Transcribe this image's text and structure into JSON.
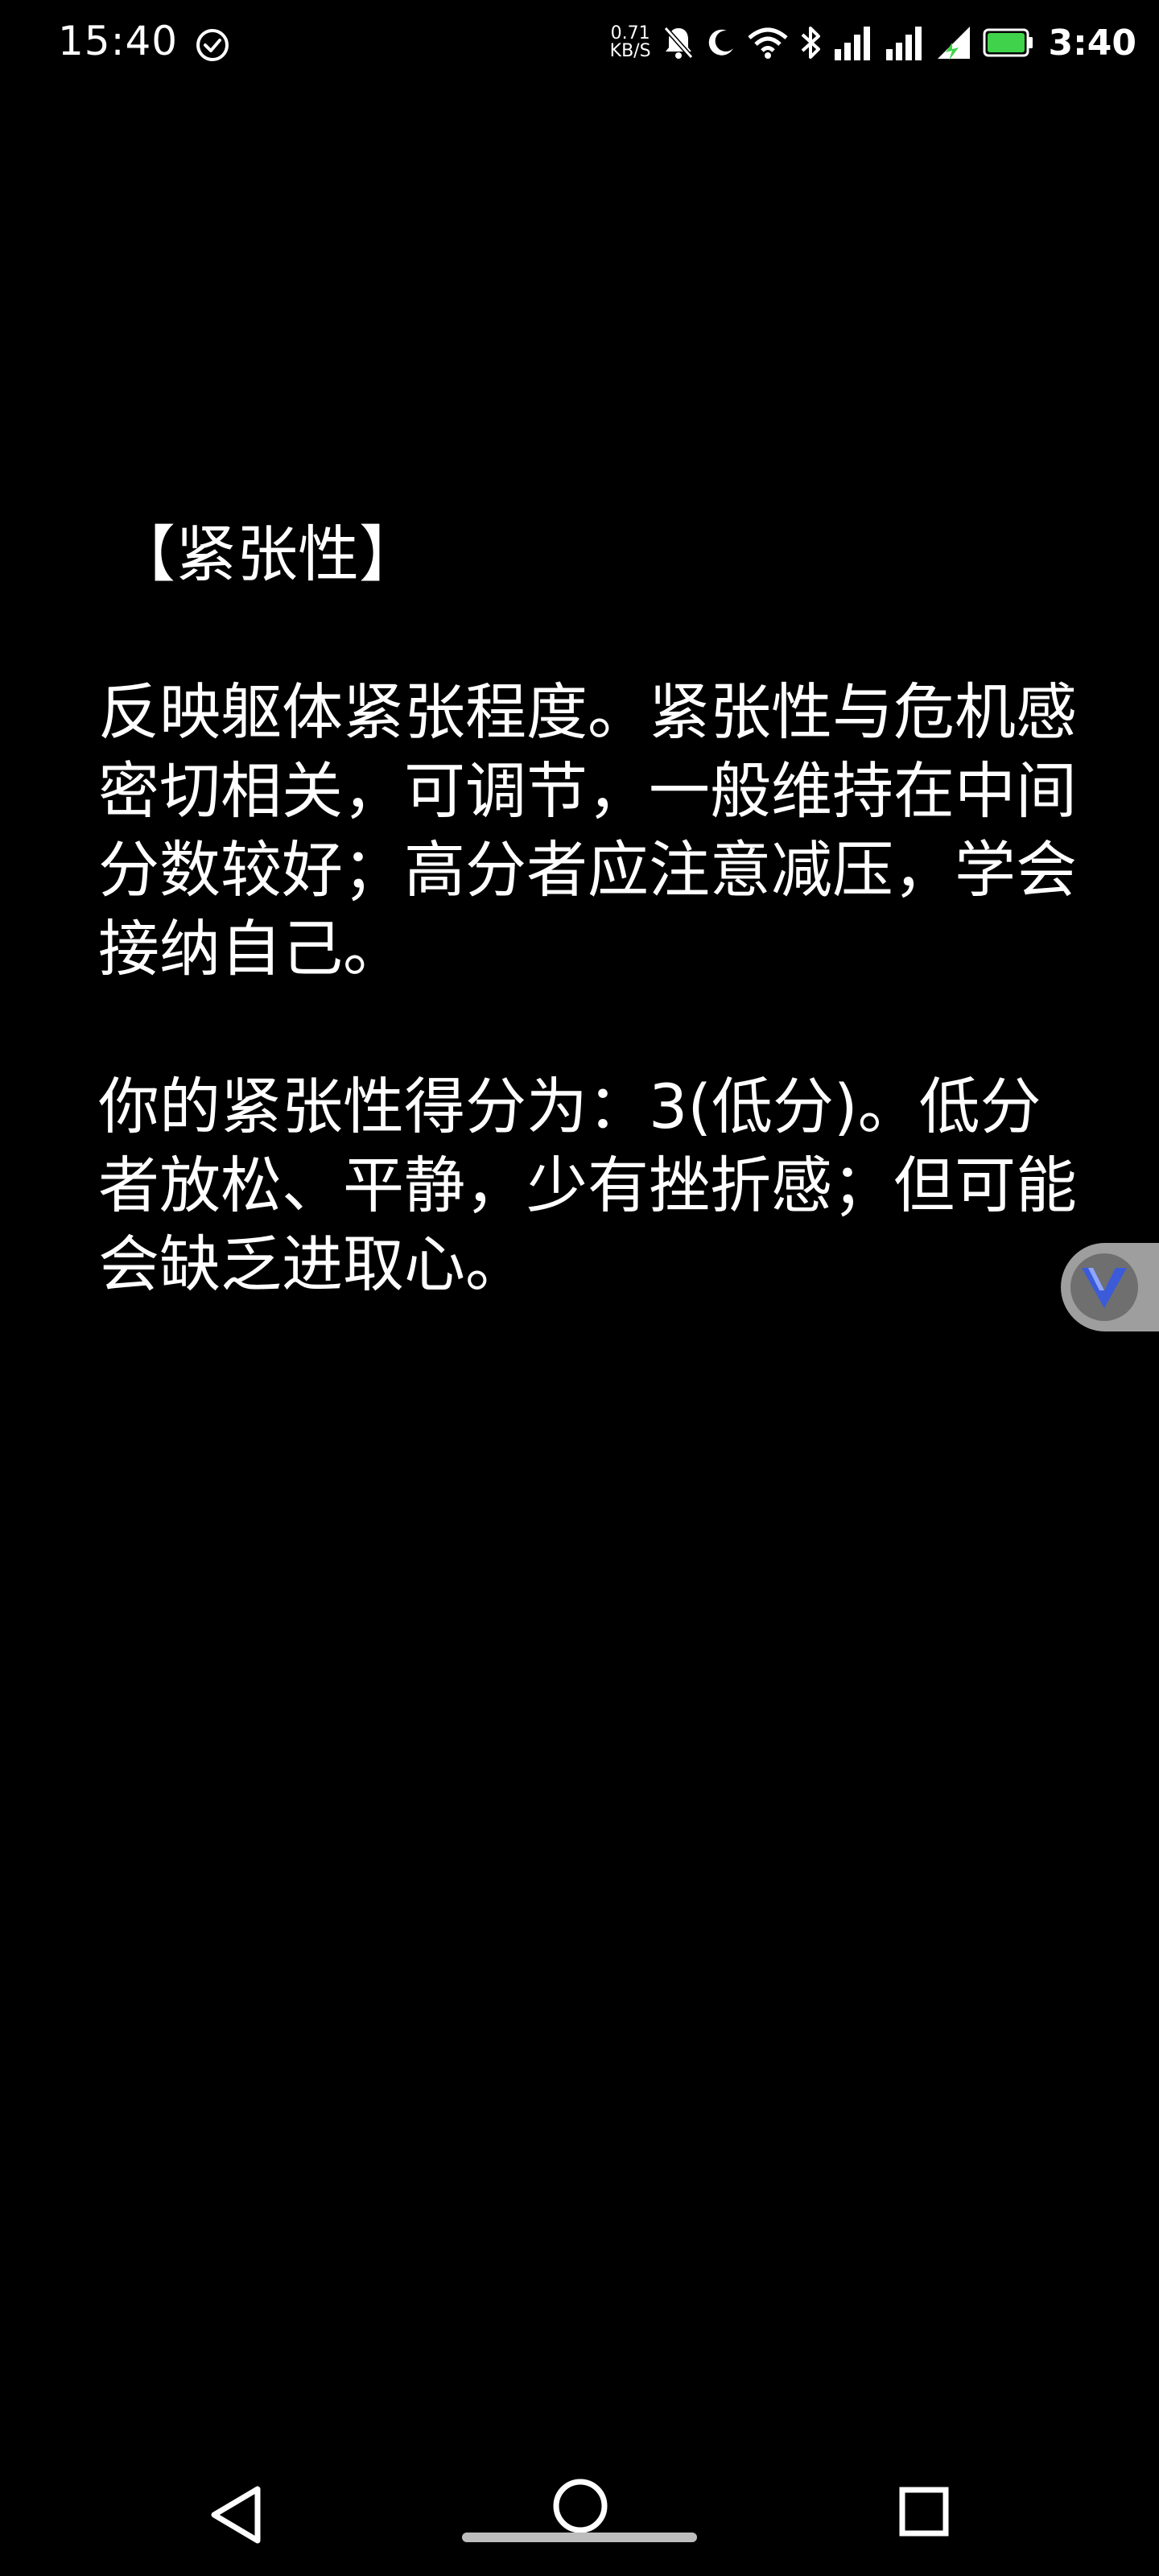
{
  "status_bar": {
    "time": "15:40",
    "net_speed_value": "0.71",
    "net_speed_unit": "KB/S",
    "battery_text": "3:40",
    "icons": [
      "check-circle-icon",
      "mute-bell-icon",
      "moon-icon",
      "wifi-icon",
      "bluetooth-icon",
      "signal-icon",
      "signal-icon",
      "charging-signal-icon",
      "battery-icon"
    ]
  },
  "content": {
    "title": "【紧张性】",
    "description": "反映躯体紧张程度。紧张性与危机感密切相关，可调节，一般维持在中间分数较好；高分者应注意减压，学会接纳自己。",
    "result": "你的紧张性得分为：3(低分)。低分者放松、平静，少有挫折感；但可能会缺乏进取心。"
  },
  "floating_button": {
    "icon": "v-logo-icon"
  },
  "nav_bar": {
    "back": "back-triangle-icon",
    "home": "home-circle-icon",
    "recent": "recent-square-icon"
  },
  "colors": {
    "background": "#000000",
    "text": "#ffffff",
    "accent": "#3b5bd9",
    "battery": "#3fd24a"
  }
}
